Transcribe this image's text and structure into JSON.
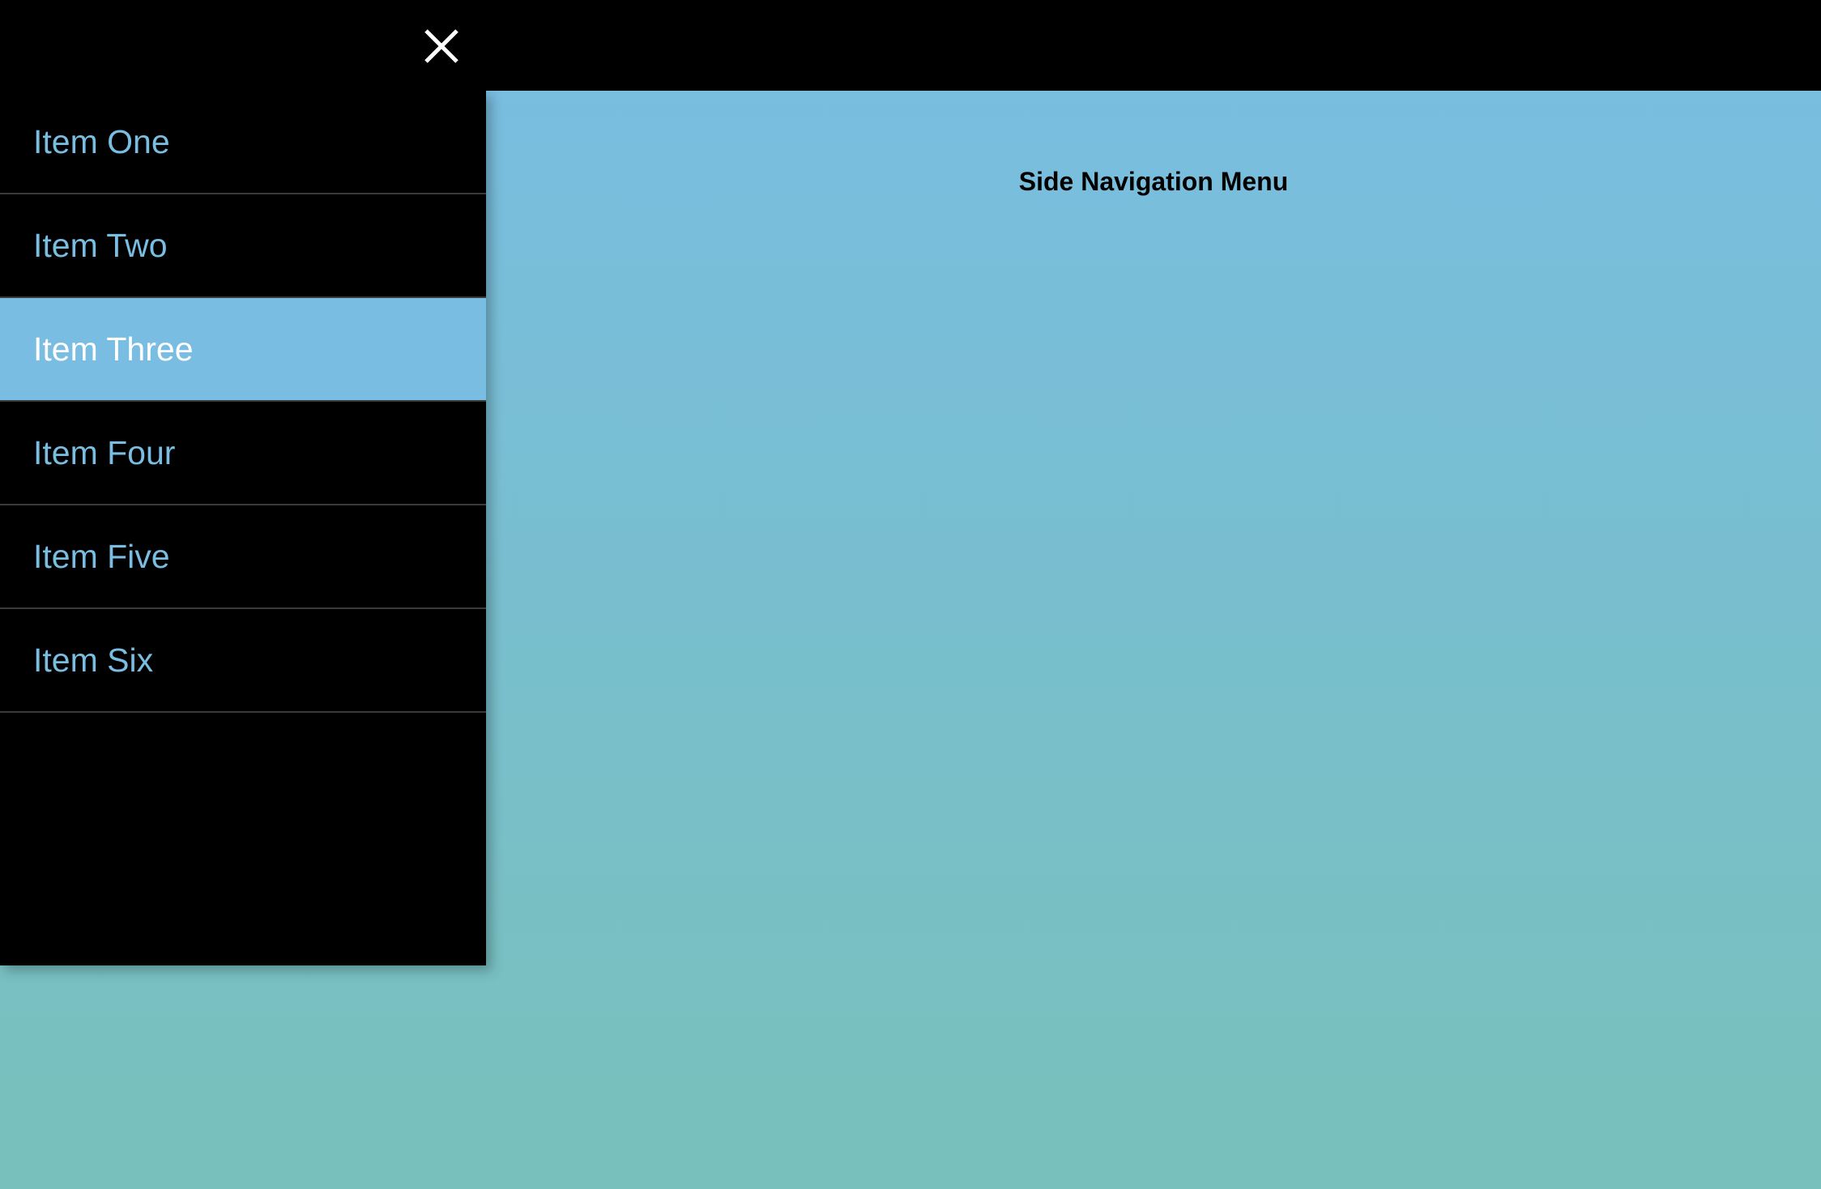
{
  "close_icon": "close-icon",
  "page_title": "Side Navigation Menu",
  "colors": {
    "accent": "#79bde2",
    "sidebar_background": "#000000",
    "active_item_text": "#ffffff",
    "gradient_top": "#79bde2",
    "gradient_bottom": "#78c0bb"
  },
  "sidebar": {
    "items": [
      {
        "label": "Item One",
        "active": false
      },
      {
        "label": "Item Two",
        "active": false
      },
      {
        "label": "Item Three",
        "active": true
      },
      {
        "label": "Item Four",
        "active": false
      },
      {
        "label": "Item Five",
        "active": false
      },
      {
        "label": "Item Six",
        "active": false
      }
    ]
  }
}
